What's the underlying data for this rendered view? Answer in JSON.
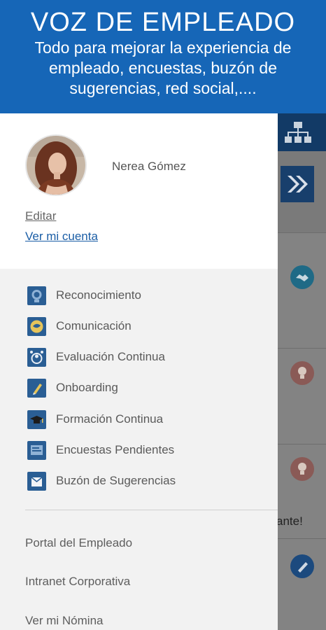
{
  "banner": {
    "title": "VOZ DE EMPLEADO",
    "subtitle": "Todo para mejorar la experiencia de empleado, encuestas, buzón de sugerencias, red social,...."
  },
  "profile": {
    "name": "Nerea Gómez",
    "edit_label": "Editar",
    "account_label": "Ver mi cuenta"
  },
  "menu": {
    "items": [
      {
        "label": "Reconocimiento",
        "icon": "recognition-icon"
      },
      {
        "label": "Comunicación",
        "icon": "communication-icon"
      },
      {
        "label": "Evaluación Continua",
        "icon": "evaluation-icon"
      },
      {
        "label": "Onboarding",
        "icon": "onboarding-icon"
      },
      {
        "label": "Formación Continua",
        "icon": "training-icon"
      },
      {
        "label": "Encuestas Pendientes",
        "icon": "surveys-icon"
      },
      {
        "label": "Buzón de Sugerencias",
        "icon": "suggestions-icon"
      }
    ]
  },
  "links": {
    "portal": "Portal del Empleado",
    "intranet": "Intranet Corporativa",
    "payroll": "Ver mi Nómina"
  },
  "background": {
    "partial_text": "ante!"
  },
  "colors": {
    "banner": "#1666b7",
    "accent_link": "#1b5ea6",
    "drawer_bg": "#f2f2f2",
    "menu_icon_bg": "#2a5e94"
  }
}
